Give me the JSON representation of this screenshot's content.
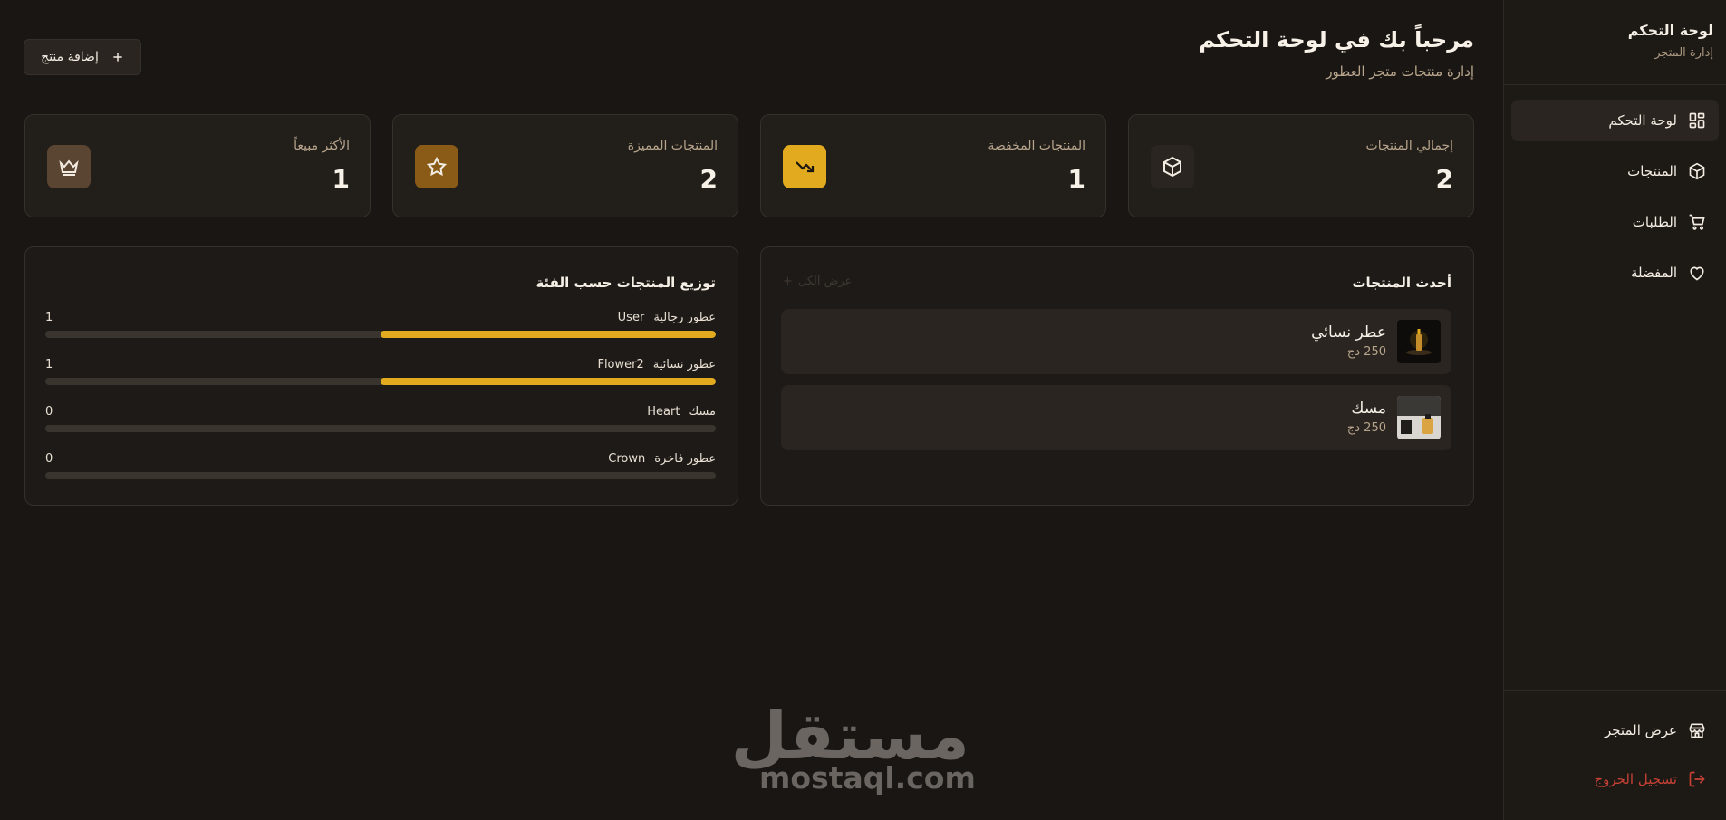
{
  "sidebar": {
    "title": "لوحة التحكم",
    "subtitle": "إدارة المتجر",
    "items": [
      {
        "label": "لوحة التحكم",
        "icon": "grid-icon",
        "active": true
      },
      {
        "label": "المنتجات",
        "icon": "box-icon"
      },
      {
        "label": "الطلبات",
        "icon": "cart-icon"
      },
      {
        "label": "المفضلة",
        "icon": "heart-icon"
      }
    ],
    "view_store": "عرض المتجر",
    "logout": "تسجيل الخروج"
  },
  "header": {
    "title": "مرحباً بك في لوحة التحكم",
    "subtitle": "إدارة منتجات متجر العطور",
    "add_button": "إضافة منتج"
  },
  "stats": [
    {
      "label": "إجمالي المنتجات",
      "value": "2",
      "icon": "box-icon",
      "color": "#2a2520"
    },
    {
      "label": "المنتجات المخفضة",
      "value": "1",
      "icon": "trending-down-icon",
      "color": "#e2aa1f"
    },
    {
      "label": "المنتجات المميزة",
      "value": "2",
      "icon": "star-icon",
      "color": "#8a5a17"
    },
    {
      "label": "الأكثر مبيعاً",
      "value": "1",
      "icon": "crown-icon",
      "color": "#5a4432"
    }
  ],
  "latest": {
    "title": "أحدث المنتجات",
    "view_all": "عرض الكل",
    "products": [
      {
        "name": "عطر نسائي",
        "price": "250 دج"
      },
      {
        "name": "مسك",
        "price": "250 دج"
      }
    ]
  },
  "categories": {
    "title": "توزيع المنتجات حسب الفئة",
    "items": [
      {
        "icon_text": "User",
        "name": "عطور رجالية",
        "count": "1",
        "fraction": 0.5
      },
      {
        "icon_text": "Flower2",
        "name": "عطور نسائية",
        "count": "1",
        "fraction": 0.5
      },
      {
        "icon_text": "Heart",
        "name": "مسك",
        "count": "0",
        "fraction": 0
      },
      {
        "icon_text": "Crown",
        "name": "عطور فاخرة",
        "count": "0",
        "fraction": 0
      }
    ]
  },
  "watermark": {
    "ar": "مستقل",
    "en": "mostaql.com"
  },
  "colors": {
    "accent": "#e2aa1f",
    "danger": "#c74135",
    "background": "#1a1613"
  }
}
